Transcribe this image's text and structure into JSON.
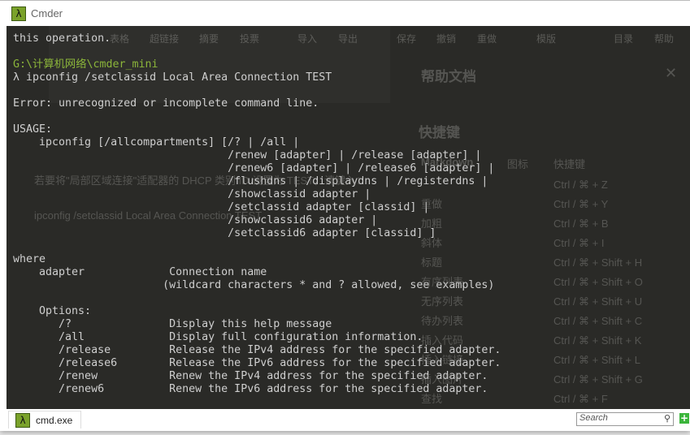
{
  "window": {
    "title": "Cmder",
    "icon": "lambda-icon"
  },
  "background_app": {
    "toolbar": [
      "表格",
      "超链接",
      "摘要",
      "投票",
      "导入",
      "导出",
      "保存",
      "撤销",
      "重做",
      "模版",
      "目录",
      "帮助"
    ],
    "help_title": "帮助文档",
    "shortcuts_title": "快捷键",
    "columns": [
      "Markdown",
      "图标",
      "快捷键"
    ],
    "rows": [
      [
        "撤销",
        "Ctrl / ⌘ + Z"
      ],
      [
        "重做",
        "Ctrl / ⌘ + Y"
      ],
      [
        "加粗",
        "Ctrl / ⌘ + B"
      ],
      [
        "斜体",
        "Ctrl / ⌘ + I"
      ],
      [
        "标题",
        "Ctrl / ⌘ + Shift + H"
      ],
      [
        "有序列表",
        "Ctrl / ⌘ + Shift + O"
      ],
      [
        "无序列表",
        "Ctrl / ⌘ + Shift + U"
      ],
      [
        "待办列表",
        "Ctrl / ⌘ + Shift + C"
      ],
      [
        "插入代码",
        "Ctrl / ⌘ + Shift + K"
      ],
      [
        "插入链接",
        "Ctrl / ⌘ + Shift + L"
      ],
      [
        "插入图片",
        "Ctrl / ⌘ + Shift + G"
      ],
      [
        "查找",
        "Ctrl / ⌘ + F"
      ]
    ],
    "doc_text": [
      "若要将\"局部区域连接\"适配器的 DHCP 类别 ID 设置为 TEST，请键入：",
      "ipconfig /setclassid Local Area Connection TEST"
    ]
  },
  "terminal": {
    "lines_before": "this operation.\n\n",
    "prompt_path": "G:\\计算机网络\\cmder_mini",
    "lines_after": "\nλ ipconfig /setclassid Local Area Connection TEST\n\nError: unrecognized or incomplete command line.\n\nUSAGE:\n    ipconfig [/allcompartments] [/? | /all |\n                                 /renew [adapter] | /release [adapter] |\n                                 /renew6 [adapter] | /release6 [adapter] |\n                                 /flushdns | /displaydns | /registerdns |\n                                 /showclassid adapter |\n                                 /setclassid adapter [classid] |\n                                 /showclassid6 adapter |\n                                 /setclassid6 adapter [classid] ]\n\nwhere\n    adapter             Connection name\n                       (wildcard characters * and ? allowed, see examples)\n\n    Options:\n       /?               Display this help message\n       /all             Display full configuration information.\n       /release         Release the IPv4 address for the specified adapter.\n       /release6        Release the IPv6 address for the specified adapter.\n       /renew           Renew the IPv4 address for the specified adapter.\n       /renew6          Renew the IPv6 address for the specified adapter."
  },
  "tabbar": {
    "tab_label": "cmd.exe",
    "search_placeholder": "Search",
    "search_icon": "magnifier-icon",
    "new_tab_icon": "plus-icon"
  }
}
